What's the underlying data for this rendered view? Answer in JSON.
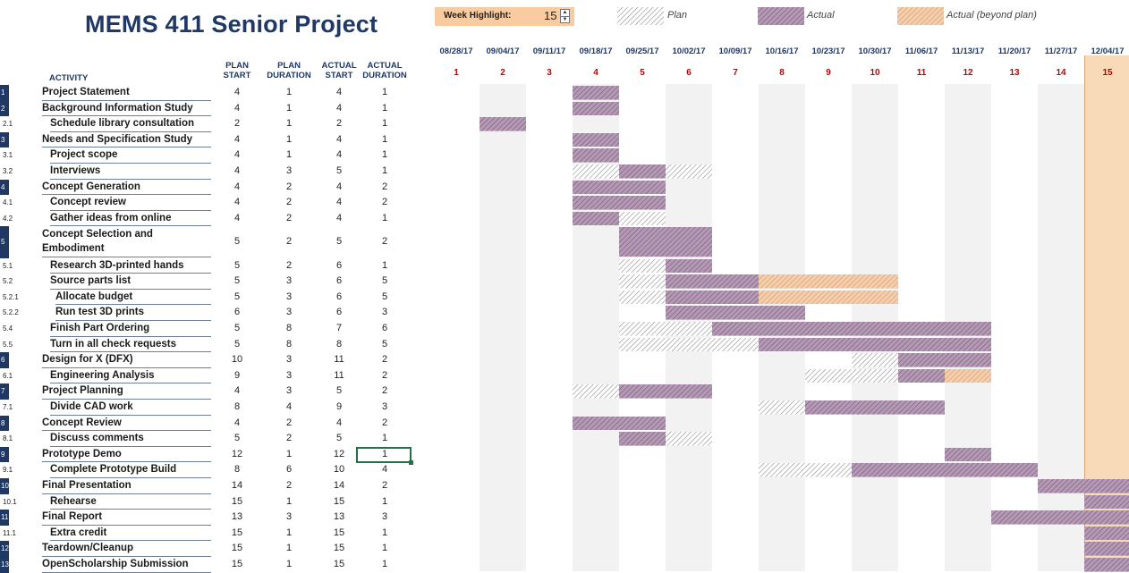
{
  "title": "MEMS 411 Senior Project",
  "week_highlight": {
    "label": "Week Highlight:",
    "value": "15",
    "up": "▲",
    "down": "▼"
  },
  "legend": {
    "plan": "Plan",
    "actual": "Actual",
    "beyond": "Actual (beyond plan)"
  },
  "colors": {
    "title": "#1f3864",
    "plan_hatch": "#a6a6a6",
    "actual": "#8e6f8e",
    "beyond": "#e9ad7b",
    "highlight_col": "#f8d9b8",
    "week_num": "#c00000",
    "shade": "#f2f2f2"
  },
  "columns": {
    "activity": "ACTIVITY",
    "plan_start": [
      "PLAN",
      "START"
    ],
    "plan_duration": [
      "PLAN",
      "DURATION"
    ],
    "actual_start": [
      "ACTUAL",
      "START"
    ],
    "actual_duration": [
      "ACTUAL",
      "DURATION"
    ]
  },
  "weeks": [
    {
      "date": "08/28/17",
      "num": "1"
    },
    {
      "date": "09/04/17",
      "num": "2"
    },
    {
      "date": "09/11/17",
      "num": "3"
    },
    {
      "date": "09/18/17",
      "num": "4"
    },
    {
      "date": "09/25/17",
      "num": "5"
    },
    {
      "date": "10/02/17",
      "num": "6"
    },
    {
      "date": "10/09/17",
      "num": "7"
    },
    {
      "date": "10/16/17",
      "num": "8"
    },
    {
      "date": "10/23/17",
      "num": "9"
    },
    {
      "date": "10/30/17",
      "num": "10"
    },
    {
      "date": "11/06/17",
      "num": "11"
    },
    {
      "date": "11/13/17",
      "num": "12"
    },
    {
      "date": "11/20/17",
      "num": "13"
    },
    {
      "date": "11/27/17",
      "num": "14"
    },
    {
      "date": "12/04/17",
      "num": "15"
    }
  ],
  "activities": [
    {
      "num": "1",
      "top": true,
      "name": "Project Statement",
      "ps": "4",
      "pd": "1",
      "as": "4",
      "ad": "1"
    },
    {
      "num": "2",
      "top": true,
      "name": "Background Information Study",
      "ps": "4",
      "pd": "1",
      "as": "4",
      "ad": "1"
    },
    {
      "num": "2.1",
      "top": false,
      "name": "Schedule library consultation",
      "ps": "2",
      "pd": "1",
      "as": "2",
      "ad": "1"
    },
    {
      "num": "3",
      "top": true,
      "name": "Needs and Specification Study",
      "ps": "4",
      "pd": "1",
      "as": "4",
      "ad": "1"
    },
    {
      "num": "3.1",
      "top": false,
      "name": "Project scope",
      "ps": "4",
      "pd": "1",
      "as": "4",
      "ad": "1"
    },
    {
      "num": "3.2",
      "top": false,
      "name": "Interviews",
      "ps": "4",
      "pd": "3",
      "as": "5",
      "ad": "1"
    },
    {
      "num": "4",
      "top": true,
      "name": "Concept Generation",
      "ps": "4",
      "pd": "2",
      "as": "4",
      "ad": "2"
    },
    {
      "num": "4.1",
      "top": false,
      "name": "Concept review",
      "ps": "4",
      "pd": "2",
      "as": "4",
      "ad": "2"
    },
    {
      "num": "4.2",
      "top": false,
      "name": "Gather ideas from online",
      "ps": "4",
      "pd": "2",
      "as": "4",
      "ad": "1"
    },
    {
      "num": "5",
      "top": true,
      "name": "Concept Selection and Embodiment",
      "ps": "5",
      "pd": "2",
      "as": "5",
      "ad": "2",
      "double": true
    },
    {
      "num": "5.1",
      "top": false,
      "name": "Research 3D-printed hands",
      "ps": "5",
      "pd": "2",
      "as": "6",
      "ad": "1"
    },
    {
      "num": "5.2",
      "top": false,
      "name": "Source parts list",
      "ps": "5",
      "pd": "3",
      "as": "6",
      "ad": "5"
    },
    {
      "num": "5.2.1",
      "top": false,
      "name": "Allocate budget",
      "ps": "5",
      "pd": "3",
      "as": "6",
      "ad": "5",
      "indent": true
    },
    {
      "num": "5.2.2",
      "top": false,
      "name": "Run test 3D prints",
      "ps": "6",
      "pd": "3",
      "as": "6",
      "ad": "3",
      "indent": true
    },
    {
      "num": "5.4",
      "top": false,
      "name": "Finish Part Ordering",
      "ps": "5",
      "pd": "8",
      "as": "7",
      "ad": "6"
    },
    {
      "num": "5.5",
      "top": false,
      "name": "Turn in all check requests",
      "ps": "5",
      "pd": "8",
      "as": "8",
      "ad": "5"
    },
    {
      "num": "6",
      "top": true,
      "name": "Design for X (DFX)",
      "ps": "10",
      "pd": "3",
      "as": "11",
      "ad": "2"
    },
    {
      "num": "6.1",
      "top": false,
      "name": "Engineering Analysis",
      "ps": "9",
      "pd": "3",
      "as": "11",
      "ad": "2"
    },
    {
      "num": "7",
      "top": true,
      "name": "Project Planning",
      "ps": "4",
      "pd": "3",
      "as": "5",
      "ad": "2"
    },
    {
      "num": "7.1",
      "top": false,
      "name": "Divide CAD work",
      "ps": "8",
      "pd": "4",
      "as": "9",
      "ad": "3"
    },
    {
      "num": "8",
      "top": true,
      "name": "Concept Review",
      "ps": "4",
      "pd": "2",
      "as": "4",
      "ad": "2"
    },
    {
      "num": "8.1",
      "top": false,
      "name": "Discuss comments",
      "ps": "5",
      "pd": "2",
      "as": "5",
      "ad": "1"
    },
    {
      "num": "9",
      "top": true,
      "name": "Prototype Demo",
      "ps": "12",
      "pd": "1",
      "as": "12",
      "ad": "1"
    },
    {
      "num": "9.1",
      "top": false,
      "name": "Complete Prototype Build",
      "ps": "8",
      "pd": "6",
      "as": "10",
      "ad": "4"
    },
    {
      "num": "10",
      "top": true,
      "name": "Final Presentation",
      "ps": "14",
      "pd": "2",
      "as": "14",
      "ad": "2"
    },
    {
      "num": "10.1",
      "top": false,
      "name": "Rehearse",
      "ps": "15",
      "pd": "1",
      "as": "15",
      "ad": "1"
    },
    {
      "num": "11",
      "top": true,
      "name": "Final Report",
      "ps": "13",
      "pd": "3",
      "as": "13",
      "ad": "3"
    },
    {
      "num": "11.1",
      "top": false,
      "name": "Extra credit",
      "ps": "15",
      "pd": "1",
      "as": "15",
      "ad": "1"
    },
    {
      "num": "12",
      "top": true,
      "name": "Teardown/Cleanup",
      "ps": "15",
      "pd": "1",
      "as": "15",
      "ad": "1"
    },
    {
      "num": "13",
      "top": true,
      "name": "OpenScholarship Submission",
      "ps": "15",
      "pd": "1",
      "as": "15",
      "ad": "1"
    }
  ]
}
